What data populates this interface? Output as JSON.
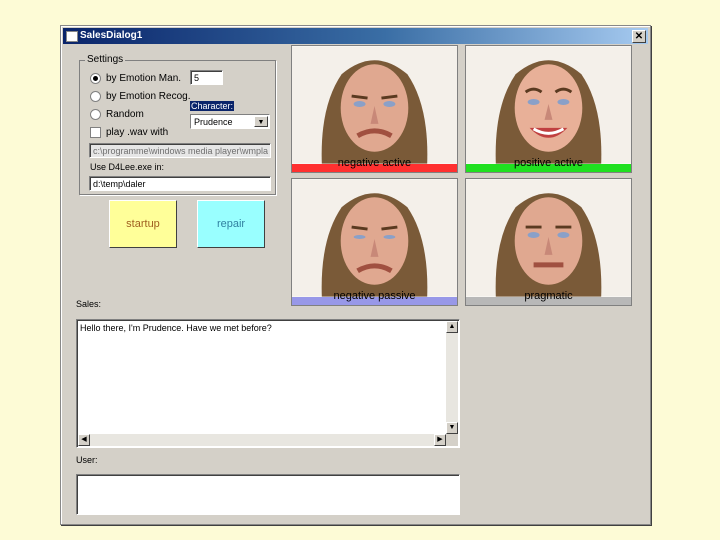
{
  "window": {
    "title": "SalesDialog1",
    "close_glyph": "✕"
  },
  "settings": {
    "legend": "Settings",
    "opt_by_emotion_man": "by Emotion Man.",
    "emotion_value": "5",
    "opt_by_emotion_recog": "by Emotion Recog.",
    "opt_random": "Random",
    "character_label": "Character:",
    "character_value": "Prudence",
    "play_wav_label": "play .wav with",
    "wav_path": "c:\\programme\\windows media player\\wmpla",
    "use_exe_label": "Use D4Lee.exe in:",
    "exe_path": "d:\\temp\\daler"
  },
  "buttons": {
    "startup": "startup",
    "repair": "repair"
  },
  "sales": {
    "label": "Sales:",
    "text": "Hello there, I'm Prudence. Have we met before?"
  },
  "user": {
    "label": "User:",
    "text": ""
  },
  "emotions": [
    {
      "label": "negative active",
      "color": "#ff3030"
    },
    {
      "label": "positive active",
      "color": "#20e020"
    },
    {
      "label": "negative passive",
      "color": "#9898e8"
    },
    {
      "label": "pragmatic",
      "color": "#b8b8b8"
    }
  ]
}
